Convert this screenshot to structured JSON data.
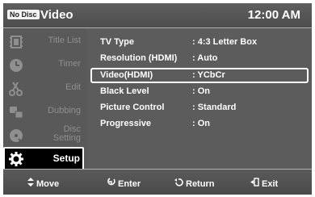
{
  "header": {
    "badge": "No Disc",
    "title": "Video",
    "clock": "12:00 AM"
  },
  "sidebar": {
    "items": [
      {
        "label": "Title List",
        "icon": "film-strip-icon",
        "active": false
      },
      {
        "label": "Timer",
        "icon": "clock-icon",
        "active": false
      },
      {
        "label": "Edit",
        "icon": "scissors-icon",
        "active": false
      },
      {
        "label": "Dubbing",
        "icon": "dubbing-icon",
        "active": false
      },
      {
        "label": "Disc Setting",
        "icon": "disc-icon",
        "active": false
      },
      {
        "label": "Setup",
        "icon": "gear-icon",
        "active": true
      }
    ],
    "disc_setting_line1": "Disc",
    "disc_setting_line2": "Setting"
  },
  "settings": {
    "rows": [
      {
        "key": "TV Type",
        "value": ": 4:3 Letter Box"
      },
      {
        "key": "Resolution (HDMI)",
        "value": ": Auto"
      },
      {
        "key": "Video(HDMI)",
        "value": ": YCbCr"
      },
      {
        "key": "Black Level",
        "value": ": On"
      },
      {
        "key": "Picture Control",
        "value": ": Standard"
      },
      {
        "key": "Progressive",
        "value": ": On"
      }
    ],
    "selected_index": 2
  },
  "footer": {
    "move": "Move",
    "enter": "Enter",
    "return": "Return",
    "exit": "Exit"
  },
  "colors": {
    "panel": "#5c5c5c",
    "sidebar_inactive_text": "#8f8f8f",
    "highlight": "#ffffff",
    "active_bg": "#000000"
  }
}
